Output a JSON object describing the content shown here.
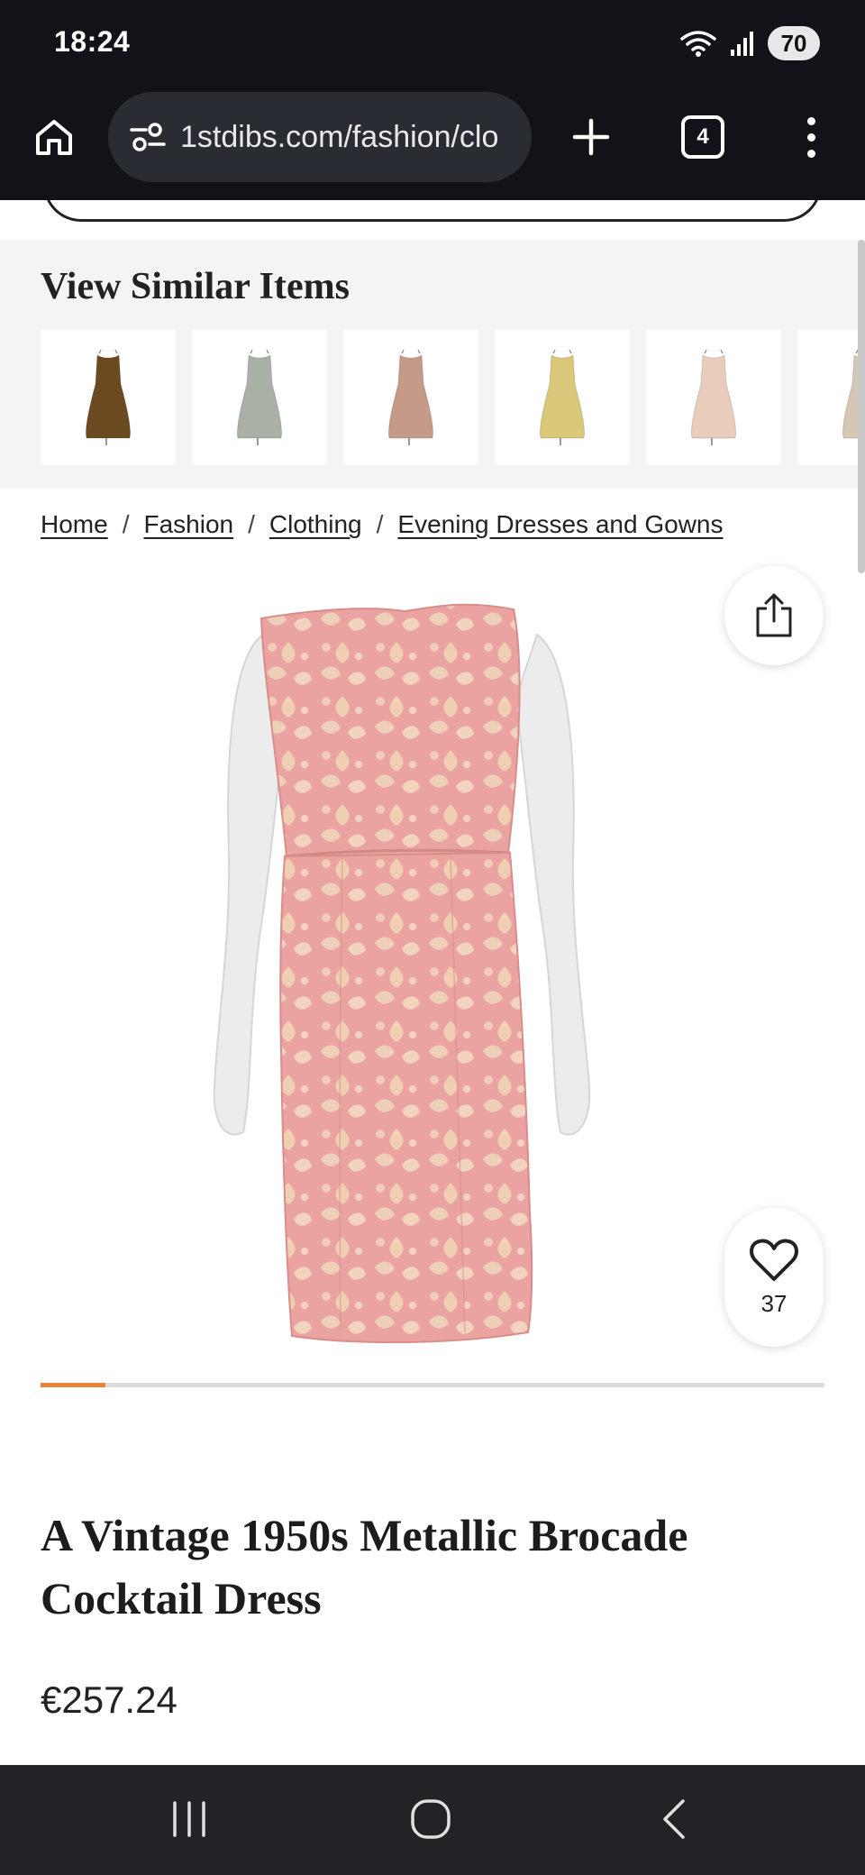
{
  "status_bar": {
    "time": "18:24",
    "battery": "70"
  },
  "browser": {
    "url": "1stdibs.com/fashion/clo",
    "tab_count": "4"
  },
  "similar": {
    "title": "View Similar Items",
    "items": [
      {
        "icon": "bronze-dress-thumbnail",
        "color": "#6b4a22"
      },
      {
        "icon": "grey-dress-thumbnail",
        "color": "#a9b1a6"
      },
      {
        "icon": "rose-dress-thumbnail",
        "color": "#c69a88"
      },
      {
        "icon": "gold-dress-thumbnail",
        "color": "#d9c77a"
      },
      {
        "icon": "blush-dress-thumbnail",
        "color": "#e8cdbb"
      },
      {
        "icon": "beige-dress-thumbnail",
        "color": "#d6c6b4"
      }
    ]
  },
  "breadcrumb": {
    "items": [
      "Home",
      "Fashion",
      "Clothing",
      "Evening Dresses and Gowns"
    ],
    "separator": "/"
  },
  "product": {
    "title": "A Vintage 1950s Metallic Brocade Cocktail Dress",
    "price": "€257.24",
    "favorite_count": "37",
    "gallery_progress": 0.083,
    "dress_color": "#eaa3a0",
    "accent_color": "#e8843a"
  }
}
